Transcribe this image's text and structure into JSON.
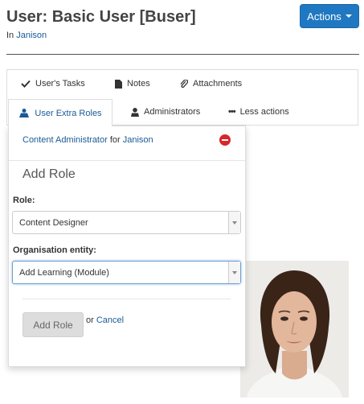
{
  "page": {
    "title": "User: Basic User [Buser]",
    "breadcrumb_prefix": "In",
    "breadcrumb_link": "Janison"
  },
  "header": {
    "actions_label": "Actions"
  },
  "tabs": [
    {
      "label": "User's Tasks",
      "icon": "check-icon"
    },
    {
      "label": "Notes",
      "icon": "document-icon"
    },
    {
      "label": "Attachments",
      "icon": "paperclip-icon"
    },
    {
      "label": "User Extra Roles",
      "icon": "users-icon",
      "active": true
    },
    {
      "label": "Administrators",
      "icon": "user-icon"
    },
    {
      "label": "Less actions",
      "icon": "ellipsis-icon"
    }
  ],
  "extra_roles": {
    "existing_role": {
      "role": "Content Administrator",
      "connector": "for",
      "entity": "Janison"
    },
    "add_heading": "Add Role",
    "role_label": "Role:",
    "role_value": "Content Designer",
    "org_label": "Organisation entity:",
    "org_value": "Add Learning (Module)",
    "add_button": "Add Role",
    "or_text": "or",
    "cancel_link": "Cancel"
  },
  "colors": {
    "primary": "#1f78c1",
    "link": "#1a5a96",
    "danger": "#d9262b",
    "border": "#dddddd"
  }
}
